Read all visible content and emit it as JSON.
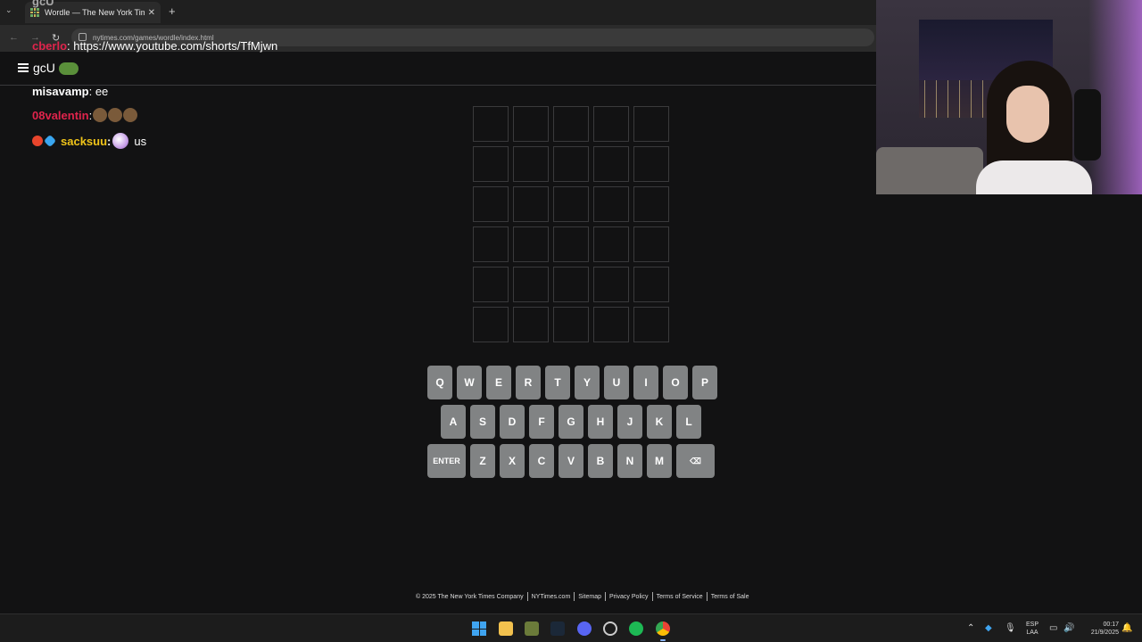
{
  "browser": {
    "tab_title": "Wordle — The New York Times",
    "url": "nytimes.com/games/wordle/index.html"
  },
  "chat": {
    "ghost_line": "gcU",
    "messages": [
      {
        "user": "cberlo",
        "user_color": "#e0244c",
        "text": ": https://www.youtube.com/shorts/TfMjwn"
      },
      {
        "user": "misavamp",
        "user_color": "#ffffff",
        "text": ": ee"
      },
      {
        "user": "08valentin",
        "user_color": "#e0244c",
        "text": ":"
      },
      {
        "user": "sacksuu",
        "user_color": "#f0c419",
        "text": ": us"
      }
    ]
  },
  "header": {
    "title": "gcU"
  },
  "board": {
    "rows": 6,
    "cols": 5
  },
  "keyboard": {
    "row1": [
      "Q",
      "W",
      "E",
      "R",
      "T",
      "Y",
      "U",
      "I",
      "O",
      "P"
    ],
    "row2": [
      "A",
      "S",
      "D",
      "F",
      "G",
      "H",
      "J",
      "K",
      "L"
    ],
    "row3": [
      "ENTER",
      "Z",
      "X",
      "C",
      "V",
      "B",
      "N",
      "M",
      "⌫"
    ]
  },
  "footer": {
    "links": [
      "© 2025 The New York Times Company",
      "NYTimes.com",
      "Sitemap",
      "Privacy Policy",
      "Terms of Service",
      "Terms of Sale"
    ]
  },
  "taskbar": {
    "language": "ESP",
    "layout": "LAA",
    "time": "00:17",
    "date": "21/9/2025"
  },
  "colors": {
    "background": "#121213",
    "tile_border": "#3a3a3c",
    "key": "#818384"
  }
}
